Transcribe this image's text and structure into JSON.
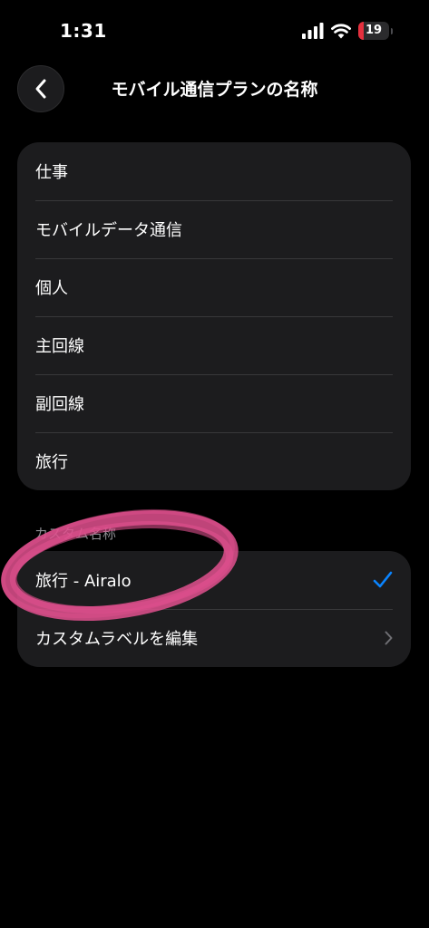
{
  "status_bar": {
    "time": "1:31",
    "battery_level": "19",
    "battery_fraction": 0.19,
    "signal_icon": "signal-bars-icon",
    "wifi_icon": "wifi-icon",
    "battery_color": "#e5303e"
  },
  "nav": {
    "back_icon": "chevron-left-icon",
    "title": "モバイル通信プランの名称"
  },
  "preset_labels": [
    "仕事",
    "モバイルデータ通信",
    "個人",
    "主回線",
    "副回線",
    "旅行"
  ],
  "custom_section": {
    "header": "カスタム名称",
    "selected_label": "旅行 - Airalo",
    "selected_icon": "checkmark-icon",
    "edit_label": "カスタムラベルを編集",
    "edit_icon": "chevron-right-icon"
  },
  "colors": {
    "accent": "#0a84ff",
    "annotation": "#e0508e",
    "background": "#000000",
    "group_background": "#1c1c1e"
  }
}
